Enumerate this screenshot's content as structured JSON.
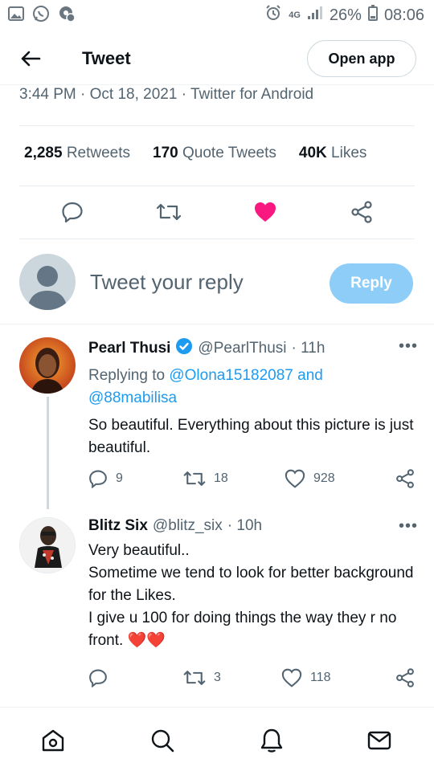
{
  "status_bar": {
    "network": "4G",
    "battery": "26%",
    "time": "08:06"
  },
  "header": {
    "title": "Tweet",
    "open_app_label": "Open app"
  },
  "tweet_meta": {
    "text": "3:44 PM · Oct 18, 2021 · Twitter for Android"
  },
  "stats": {
    "retweets_count": "2,285",
    "retweets_label": "Retweets",
    "quotes_count": "170",
    "quotes_label": "Quote Tweets",
    "likes_count": "40K",
    "likes_label": "Likes"
  },
  "reply_bar": {
    "placeholder": "Tweet your reply",
    "button_label": "Reply"
  },
  "replies": [
    {
      "name": "Pearl Thusi",
      "handle": "@PearlThusi",
      "time": "· 11h",
      "replying_prefix": "Replying to",
      "replying_to_1": "@Olona15182087 and",
      "replying_to_2": "@88mabilisa",
      "text": "So beautiful. Everything about this picture is just beautiful.",
      "reply_count": "9",
      "retweet_count": "18",
      "like_count": "928"
    },
    {
      "name": "Blitz Six",
      "handle": "@blitz_six",
      "time": "· 10h",
      "text_line_1": "Very beautiful..",
      "text_line_2": "Sometime we tend to look for better background for the Likes.",
      "text_line_3": "I give u 100 for doing things the way they r no front.",
      "emoji": "❤️❤️",
      "reply_count": "",
      "retweet_count": "3",
      "like_count": "118"
    }
  ],
  "colors": {
    "accent": "#1d9bf0",
    "like_active": "#f91880",
    "reply_button": "#8ecdf8",
    "secondary_text": "#536471"
  },
  "more_label": "•••"
}
